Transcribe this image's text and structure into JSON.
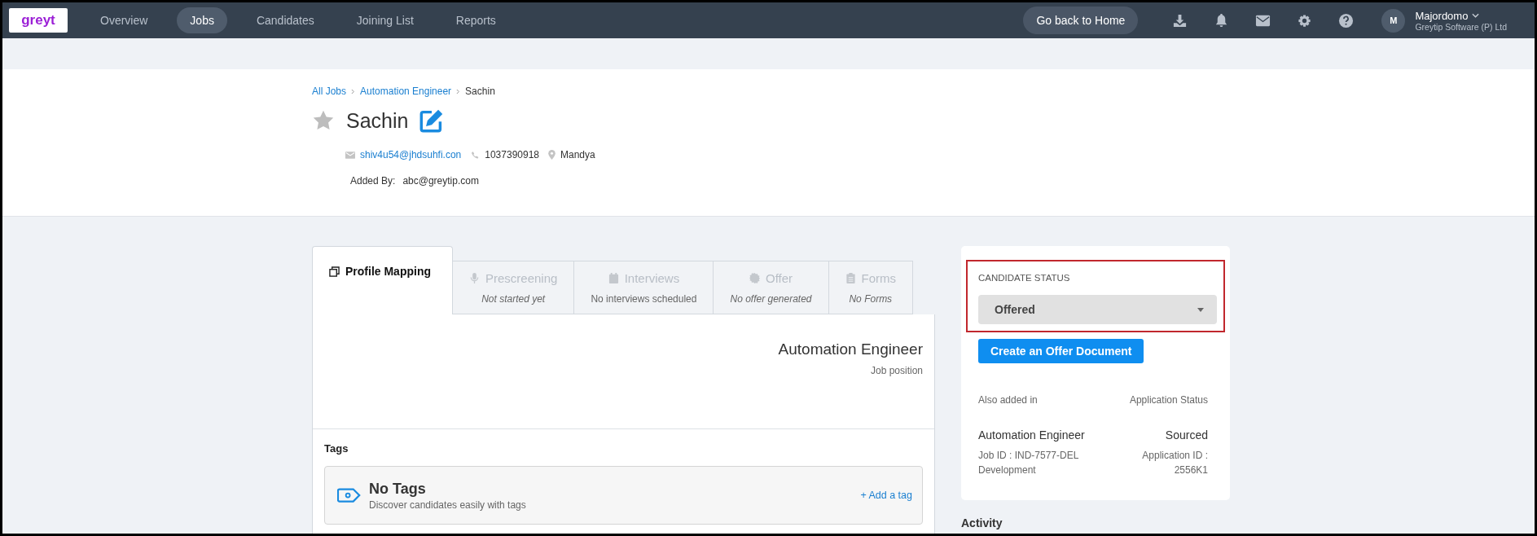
{
  "nav": {
    "logo": "greyt",
    "items": [
      {
        "label": "Overview",
        "selected": false
      },
      {
        "label": "Jobs",
        "selected": true
      },
      {
        "label": "Candidates",
        "selected": false
      },
      {
        "label": "Joining List",
        "selected": false
      },
      {
        "label": "Reports",
        "selected": false
      }
    ],
    "home_button": "Go back to Home",
    "user": {
      "initial": "M",
      "name": "Majordomo",
      "company": "Greytip Software (P) Ltd"
    }
  },
  "breadcrumb": [
    {
      "label": "All Jobs",
      "link": true
    },
    {
      "label": "Automation Engineer",
      "link": true
    },
    {
      "label": "Sachin",
      "link": false
    }
  ],
  "candidate": {
    "name": "Sachin",
    "starred": false,
    "email": "shiv4u54@jhdsuhfi.con",
    "phone": "1037390918",
    "location": "Mandya",
    "added_by_label": "Added By:",
    "added_by": "abc@greytip.com"
  },
  "tabs": [
    {
      "label": "Profile Mapping",
      "selected": true
    },
    {
      "label": "Prescreening",
      "subtitle": "Not started yet",
      "selected": false,
      "italic": true
    },
    {
      "label": "Interviews",
      "subtitle": "No interviews scheduled",
      "selected": false,
      "italic": false
    },
    {
      "label": "Offer",
      "subtitle": "No offer generated",
      "selected": false,
      "italic": true
    },
    {
      "label": "Forms",
      "subtitle": "No Forms",
      "selected": false,
      "italic": true
    }
  ],
  "profile": {
    "job_title": "Automation Engineer",
    "job_caption": "Job position"
  },
  "tags": {
    "heading": "Tags",
    "empty_title": "No Tags",
    "empty_text": "Discover candidates easily with tags",
    "add_link": "+ Add a tag"
  },
  "status_card": {
    "label": "CANDIDATE STATUS",
    "status": "Offered",
    "offer_button": "Create an Offer Document",
    "also_added_label": "Also added in",
    "app_status_label": "Application Status",
    "job": "Automation Engineer",
    "app_status": "Sourced",
    "job_id": "Job ID : IND-7577-DEL",
    "department": "Development",
    "app_id_label": "Application ID :",
    "app_id": "2556K1"
  },
  "activity": {
    "heading": "Activity"
  }
}
